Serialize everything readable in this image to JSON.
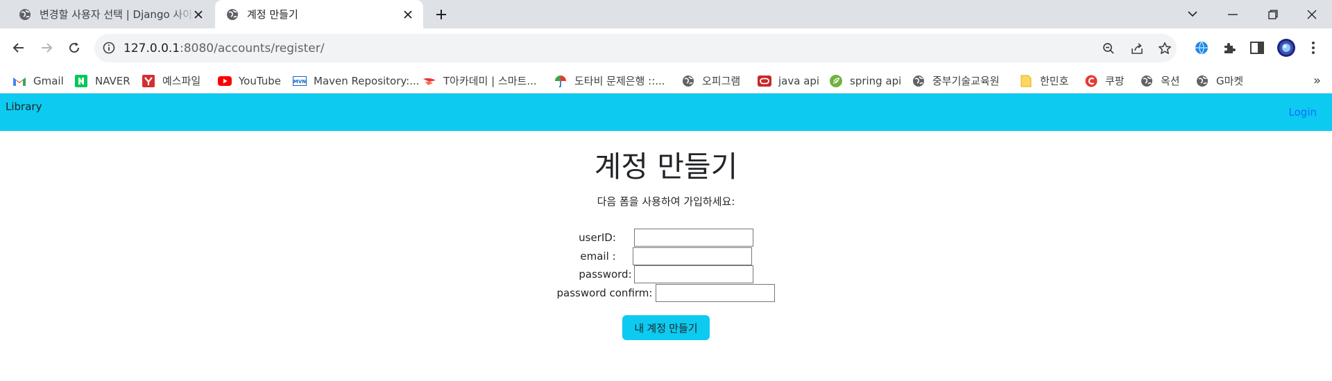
{
  "browser": {
    "tabs": [
      {
        "title": "변경할 사용자 선택 | Django 사이트 관리",
        "active": false
      },
      {
        "title": "계정 만들기",
        "active": true
      }
    ],
    "url_host": "127.0.0.1",
    "url_rest": ":8080/accounts/register/",
    "bookmarks": [
      {
        "label": "Gmail",
        "icon": "gmail-icon"
      },
      {
        "label": "NAVER",
        "icon": "naver-icon"
      },
      {
        "label": "예스파일",
        "icon": "yesfile-icon"
      },
      {
        "label": "YouTube",
        "icon": "youtube-icon"
      },
      {
        "label": "Maven Repository:...",
        "icon": "maven-icon"
      },
      {
        "label": "T아카데미 | 스마트...",
        "icon": "tacademy-icon"
      },
      {
        "label": "도타비 문제은행 ::...",
        "icon": "umbrella-icon"
      },
      {
        "label": "오피그램",
        "icon": "globe-icon"
      },
      {
        "label": "java api",
        "icon": "oracle-icon"
      },
      {
        "label": "spring api",
        "icon": "spring-icon"
      },
      {
        "label": "중부기술교육원",
        "icon": "globe-icon"
      },
      {
        "label": "한민호",
        "icon": "folder-icon"
      },
      {
        "label": "쿠팡",
        "icon": "coupang-icon"
      },
      {
        "label": "옥션",
        "icon": "globe-icon"
      },
      {
        "label": "G마켓",
        "icon": "globe-icon"
      }
    ],
    "more_bookmarks": "»"
  },
  "page": {
    "brand": "Library",
    "login": "Login",
    "heading": "계정 만들기",
    "subtitle": "다음 폼을 사용하여 가입하세요:",
    "fields": [
      {
        "label": "userID:",
        "value": ""
      },
      {
        "label": "email :",
        "value": ""
      },
      {
        "label": "password:",
        "value": ""
      },
      {
        "label": "password confirm:",
        "value": ""
      }
    ],
    "submit_label": "내 계정 만들기"
  },
  "colors": {
    "navbar": "#0dcaf0",
    "link": "#0d6efd",
    "button": "#0dcaf0"
  }
}
